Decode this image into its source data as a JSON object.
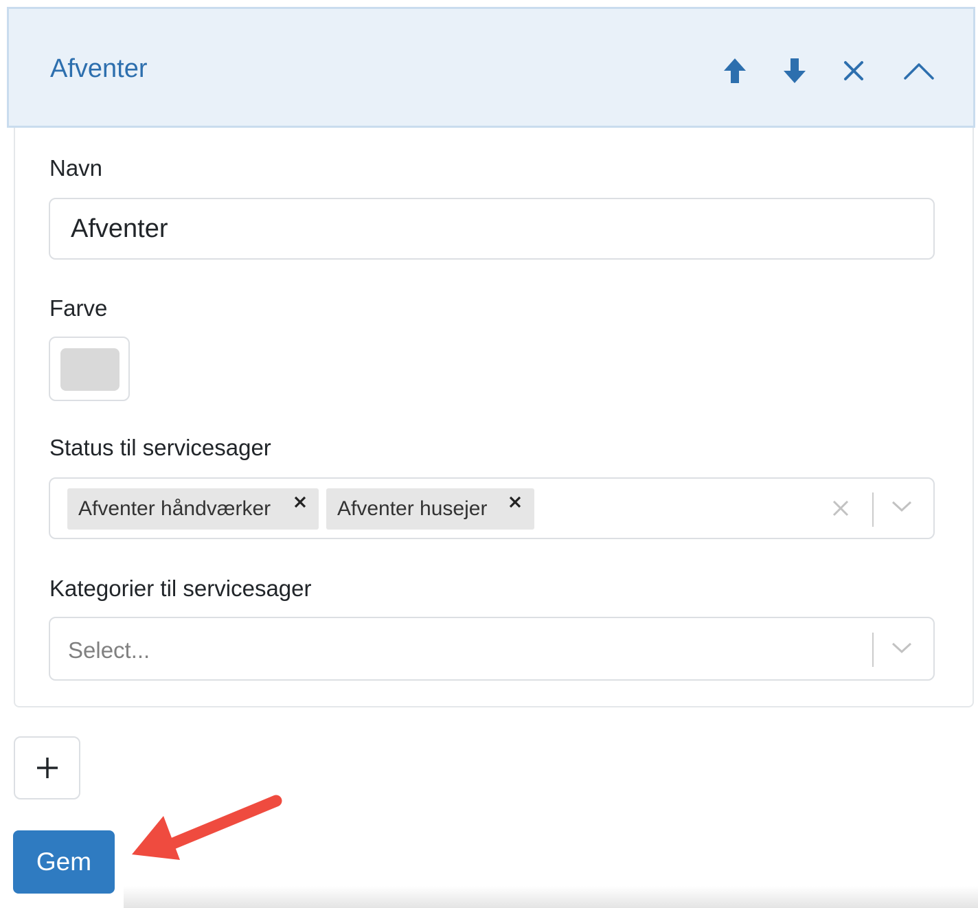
{
  "header": {
    "title": "Afventer",
    "icons": [
      "arrow-up-icon",
      "arrow-down-icon",
      "close-icon",
      "chevron-up-icon"
    ]
  },
  "fields": {
    "name_label": "Navn",
    "name_value": "Afventer",
    "color_label": "Farve",
    "color_value": "#d9d9d9",
    "status_label": "Status til servicesager",
    "status_tags": [
      "Afventer håndværker",
      "Afventer husejer"
    ],
    "category_label": "Kategorier til servicesager",
    "category_placeholder": "Select..."
  },
  "actions": {
    "add_symbol": "+",
    "save_label": "Gem"
  },
  "colors": {
    "accent": "#2f7bc1",
    "header_bg": "#e9f1f9",
    "annotation_arrow": "#ef4b3f"
  }
}
